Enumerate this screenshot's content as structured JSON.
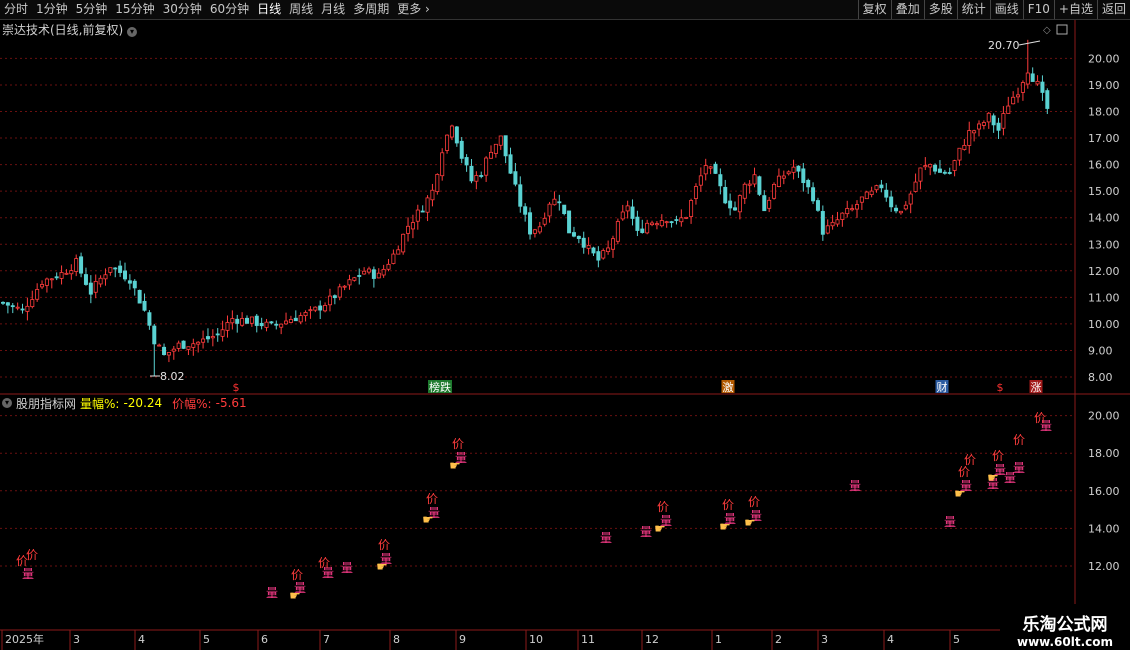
{
  "toolbar": {
    "left": [
      "分时",
      "1分钟",
      "5分钟",
      "15分钟",
      "30分钟",
      "60分钟",
      "日线",
      "周线",
      "月线",
      "多周期",
      "更多 ›"
    ],
    "active_index": 6,
    "right": [
      "复权",
      "叠加",
      "多股",
      "统计",
      "画线",
      "F10",
      "+自选",
      "返回"
    ]
  },
  "main": {
    "title": "崇达技术(日线,前复权)",
    "high_label": "20.70",
    "low_label": "8.02",
    "y_ticks": [
      "8.00",
      "9.00",
      "10.00",
      "11.00",
      "12.00",
      "13.00",
      "14.00",
      "15.00",
      "16.00",
      "17.00",
      "18.00",
      "19.00",
      "20.00"
    ],
    "event_marks": [
      {
        "label": "$",
        "color": "#ff3333",
        "bg": ""
      },
      {
        "label": "榜跌",
        "color": "#ffffff",
        "bg": "#1e7a2e"
      },
      {
        "label": "激",
        "color": "#ffffff",
        "bg": "#b35a00"
      },
      {
        "label": "财",
        "color": "#ffffff",
        "bg": "#2a5aa0"
      },
      {
        "label": "$",
        "color": "#ff3333",
        "bg": ""
      },
      {
        "label": "涨",
        "color": "#ffffff",
        "bg": "#a31a1a"
      }
    ]
  },
  "indicator": {
    "name": "股朋指标网",
    "vol_label": "量幅%:",
    "vol_value": "-20.24",
    "price_label": "价幅%:",
    "price_value": "-5.61",
    "y_ticks": [
      "12.00",
      "14.00",
      "16.00",
      "18.00",
      "20.00"
    ]
  },
  "axis": {
    "months": [
      "2025年",
      "3",
      "4",
      "5",
      "6",
      "7",
      "8",
      "9",
      "10",
      "11",
      "12",
      "1",
      "2",
      "3",
      "4",
      "5",
      "6"
    ]
  },
  "watermark": {
    "line1": "乐淘公式网",
    "line2": "www.60lt.com"
  },
  "colors": {
    "up": "#ff3c3c",
    "down": "#5ad2d2",
    "grid": "#6a1010",
    "accent": "#ff3333"
  },
  "chart_data": {
    "type": "candlestick",
    "title": "崇达技术(日线,前复权)",
    "y_ticks": [
      8,
      9,
      10,
      11,
      12,
      13,
      14,
      15,
      16,
      17,
      18,
      19,
      20
    ],
    "ylim": [
      7.6,
      21.2
    ],
    "extremes": {
      "high": 20.7,
      "low": 8.02
    },
    "close_path": [
      [
        0,
        10.8
      ],
      [
        4,
        10.5
      ],
      [
        8,
        11.6
      ],
      [
        12,
        11.9
      ],
      [
        15,
        12.3
      ],
      [
        18,
        11.2
      ],
      [
        22,
        12.2
      ],
      [
        26,
        11.7
      ],
      [
        29,
        10.5
      ],
      [
        31,
        9.4
      ],
      [
        33,
        8.8
      ],
      [
        36,
        9.2
      ],
      [
        40,
        9.3
      ],
      [
        44,
        9.6
      ],
      [
        47,
        10.2
      ],
      [
        51,
        10.1
      ],
      [
        55,
        9.9
      ],
      [
        59,
        10.2
      ],
      [
        63,
        10.4
      ],
      [
        67,
        10.9
      ],
      [
        70,
        11.4
      ],
      [
        74,
        12.0
      ],
      [
        77,
        11.8
      ],
      [
        80,
        12.6
      ],
      [
        83,
        13.7
      ],
      [
        86,
        14.4
      ],
      [
        88,
        15.0
      ],
      [
        90,
        16.6
      ],
      [
        92,
        17.6
      ],
      [
        94,
        16.3
      ],
      [
        96,
        15.4
      ],
      [
        98,
        15.7
      ],
      [
        100,
        16.6
      ],
      [
        102,
        17.0
      ],
      [
        104,
        15.7
      ],
      [
        106,
        14.5
      ],
      [
        108,
        13.5
      ],
      [
        110,
        13.7
      ],
      [
        112,
        14.6
      ],
      [
        114,
        14.7
      ],
      [
        116,
        13.5
      ],
      [
        118,
        13.3
      ],
      [
        120,
        12.8
      ],
      [
        122,
        12.4
      ],
      [
        124,
        12.8
      ],
      [
        126,
        13.7
      ],
      [
        128,
        14.5
      ],
      [
        130,
        13.4
      ],
      [
        132,
        13.8
      ],
      [
        134,
        13.9
      ],
      [
        136,
        14.0
      ],
      [
        138,
        13.8
      ],
      [
        140,
        14.1
      ],
      [
        142,
        15.1
      ],
      [
        144,
        16.0
      ],
      [
        146,
        15.5
      ],
      [
        148,
        14.7
      ],
      [
        150,
        14.3
      ],
      [
        152,
        15.2
      ],
      [
        154,
        15.6
      ],
      [
        156,
        14.3
      ],
      [
        158,
        15.2
      ],
      [
        160,
        15.6
      ],
      [
        162,
        15.9
      ],
      [
        164,
        15.4
      ],
      [
        166,
        14.8
      ],
      [
        168,
        13.5
      ],
      [
        170,
        13.7
      ],
      [
        172,
        14.1
      ],
      [
        174,
        14.3
      ],
      [
        176,
        14.7
      ],
      [
        178,
        14.9
      ],
      [
        180,
        15.2
      ],
      [
        182,
        14.5
      ],
      [
        184,
        14.2
      ],
      [
        186,
        14.9
      ],
      [
        188,
        15.8
      ],
      [
        190,
        16.0
      ],
      [
        192,
        15.7
      ],
      [
        194,
        15.7
      ],
      [
        196,
        16.5
      ],
      [
        198,
        17.2
      ],
      [
        200,
        17.4
      ],
      [
        202,
        17.8
      ],
      [
        204,
        17.3
      ],
      [
        206,
        18.3
      ],
      [
        208,
        18.8
      ],
      [
        210,
        19.6
      ],
      [
        212,
        19.0
      ],
      [
        214,
        18.1
      ]
    ]
  }
}
